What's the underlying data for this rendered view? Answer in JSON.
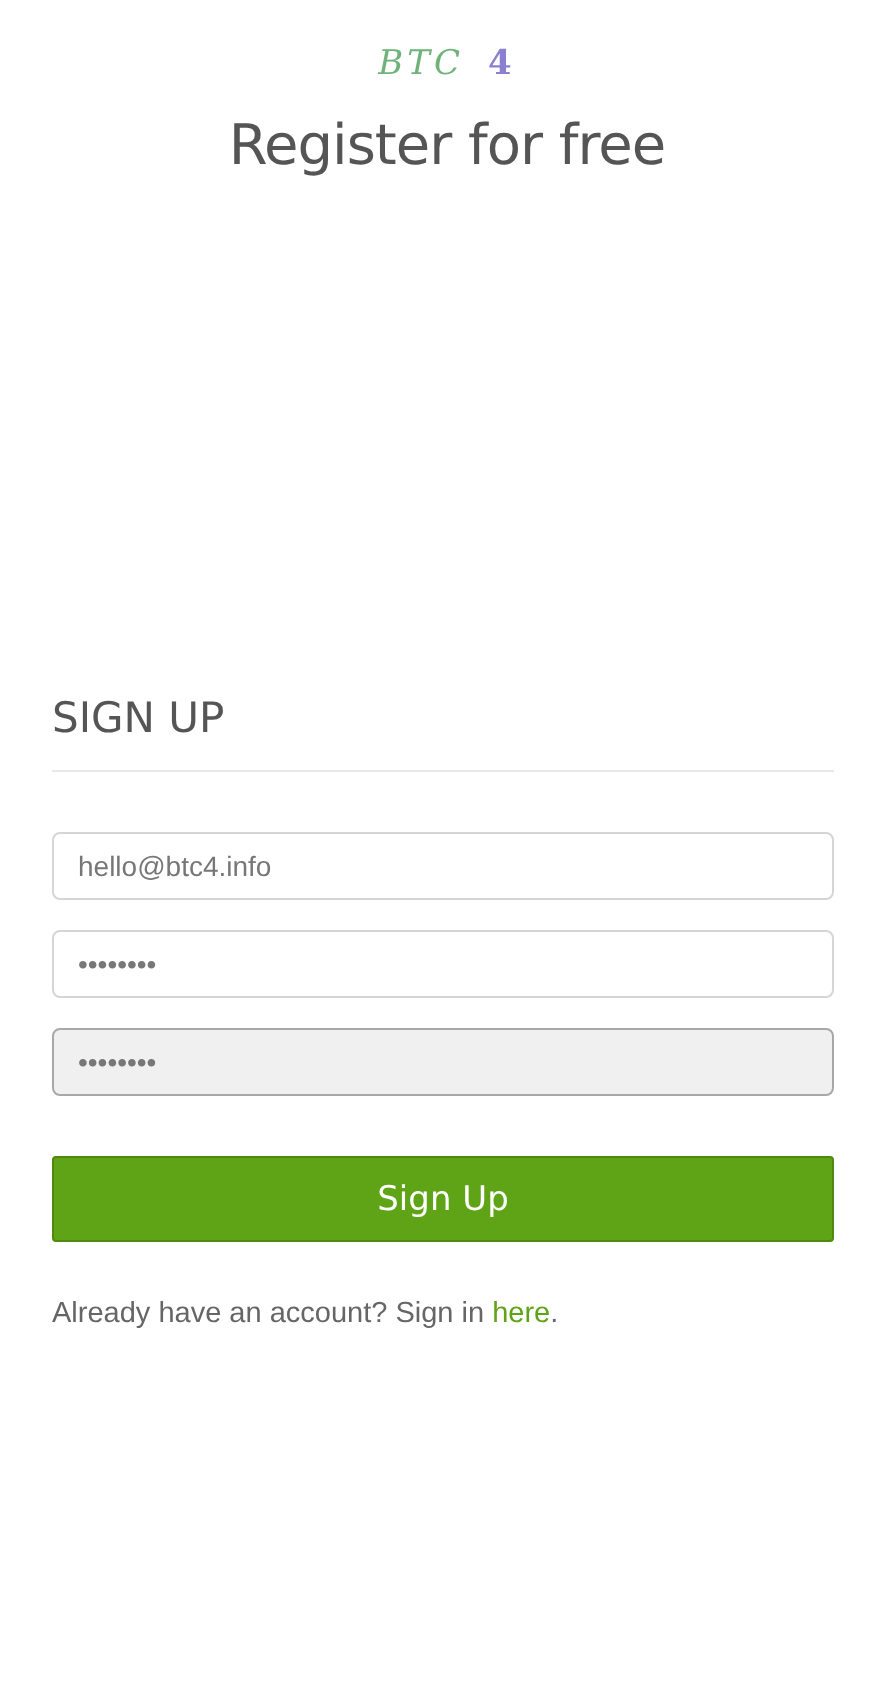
{
  "logo": {
    "text": "BTC",
    "mark": "4"
  },
  "title": "Register for free",
  "form": {
    "heading": "SIGN UP",
    "fields": [
      {
        "placeholder": "hello@btc4.info",
        "focused": false
      },
      {
        "placeholder": "••••••••",
        "focused": false
      },
      {
        "placeholder": "••••••••",
        "focused": true
      }
    ],
    "button": "Sign Up",
    "footer": {
      "text": "Already have an account? Sign in ",
      "link": "here",
      "end": "."
    }
  }
}
